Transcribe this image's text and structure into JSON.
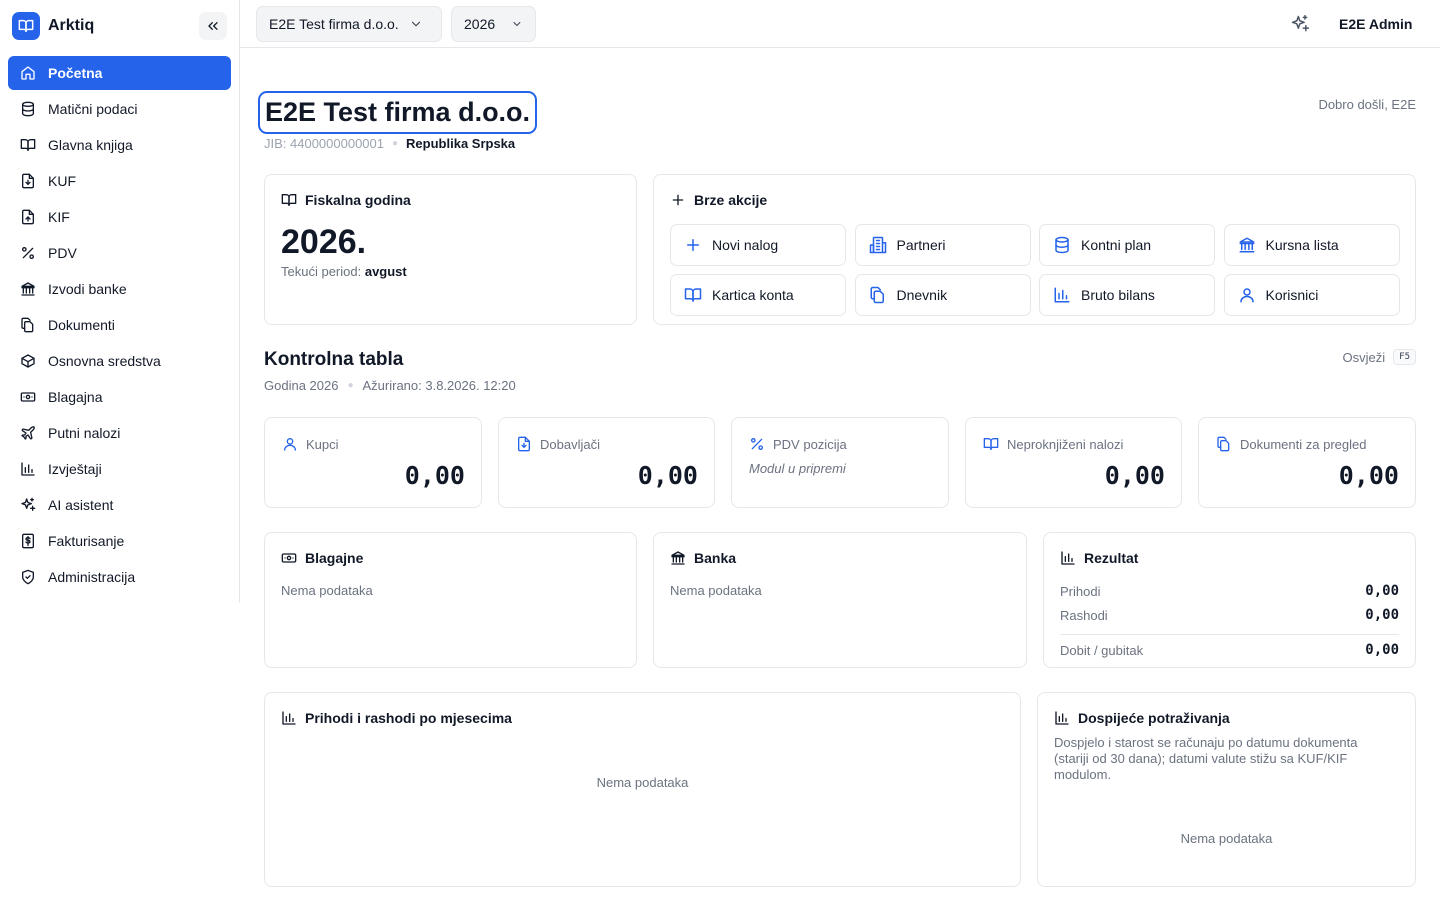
{
  "app": {
    "name": "Arktiq",
    "logo_icon": "book-open-icon",
    "accent_color": "#2563eb"
  },
  "sidebar": {
    "items": [
      {
        "label": "Početna",
        "icon": "home-icon",
        "active": true
      },
      {
        "label": "Matični podaci",
        "icon": "database-icon"
      },
      {
        "label": "Glavna knjiga",
        "icon": "book-open-icon"
      },
      {
        "label": "KUF",
        "icon": "file-download-icon"
      },
      {
        "label": "KIF",
        "icon": "file-upload-icon"
      },
      {
        "label": "PDV",
        "icon": "percent-icon"
      },
      {
        "label": "Izvodi banke",
        "icon": "bank-icon"
      },
      {
        "label": "Dokumenti",
        "icon": "files-icon"
      },
      {
        "label": "Osnovna sredstva",
        "icon": "box-icon"
      },
      {
        "label": "Blagajna",
        "icon": "cash-icon"
      },
      {
        "label": "Putni nalozi",
        "icon": "plane-icon"
      },
      {
        "label": "Izvještaji",
        "icon": "bar-chart-icon"
      },
      {
        "label": "AI asistent",
        "icon": "sparkles-icon"
      },
      {
        "label": "Fakturisanje",
        "icon": "dollar-file-icon"
      },
      {
        "label": "Administracija",
        "icon": "shield-icon"
      }
    ]
  },
  "topbar": {
    "company_select": "E2E Test firma d.o.o.",
    "year_select": "2026",
    "user_name": "E2E Admin"
  },
  "company": {
    "name": "E2E Test firma d.o.o.",
    "jib": "JIB: 4400000000001",
    "region": "Republika Srpska",
    "welcome": "Dobro došli, E2E"
  },
  "fiscal_year": {
    "title": "Fiskalna godina",
    "year": "2026.",
    "period_label": "Tekući period:",
    "period_value": "avgust"
  },
  "quick_actions": {
    "title": "Brze akcije",
    "items": [
      {
        "label": "Novi nalog",
        "icon": "plus-icon"
      },
      {
        "label": "Partneri",
        "icon": "building-icon"
      },
      {
        "label": "Kontni plan",
        "icon": "database-icon"
      },
      {
        "label": "Kursna lista",
        "icon": "bank-icon"
      },
      {
        "label": "Kartica konta",
        "icon": "book-open-icon"
      },
      {
        "label": "Dnevnik",
        "icon": "files-icon"
      },
      {
        "label": "Bruto bilans",
        "icon": "bar-chart-icon"
      },
      {
        "label": "Korisnici",
        "icon": "user-icon"
      }
    ]
  },
  "dashboard": {
    "title": "Kontrolna tabla",
    "year_label": "Godina 2026",
    "updated": "Ažurirano: 3.8.2026. 12:20",
    "refresh_label": "Osvježi",
    "refresh_key": "F5"
  },
  "stats": [
    {
      "label": "Kupci",
      "value": "0,00",
      "icon": "user-icon"
    },
    {
      "label": "Dobavljači",
      "value": "0,00",
      "icon": "file-download-icon"
    },
    {
      "label": "PDV pozicija",
      "note": "Modul u pripremi",
      "icon": "percent-icon"
    },
    {
      "label": "Neproknjiženi nalozi",
      "value": "0,00",
      "icon": "book-open-icon"
    },
    {
      "label": "Dokumenti za pregled",
      "value": "0,00",
      "icon": "files-icon"
    }
  ],
  "panels": {
    "blagajne": {
      "title": "Blagajne",
      "empty": "Nema podataka",
      "icon": "cash-icon"
    },
    "banka": {
      "title": "Banka",
      "empty": "Nema podataka",
      "icon": "bank-icon"
    },
    "rezultat": {
      "title": "Rezultat",
      "icon": "bar-chart-icon",
      "rows": [
        {
          "label": "Prihodi",
          "value": "0,00"
        },
        {
          "label": "Rashodi",
          "value": "0,00"
        },
        {
          "label": "Dobit / gubitak",
          "value": "0,00"
        }
      ]
    },
    "monthly": {
      "title": "Prihodi i rashodi po mjesecima",
      "empty": "Nema podataka",
      "icon": "bar-chart-icon"
    },
    "due": {
      "title": "Dospijeće potraživanja",
      "icon": "bar-chart-icon",
      "description": "Dospjelo i starost se računaju po datumu dokumenta (stariji od 30 dana); datumi valute stižu sa KUF/KIF modulom.",
      "empty": "Nema podataka"
    }
  }
}
